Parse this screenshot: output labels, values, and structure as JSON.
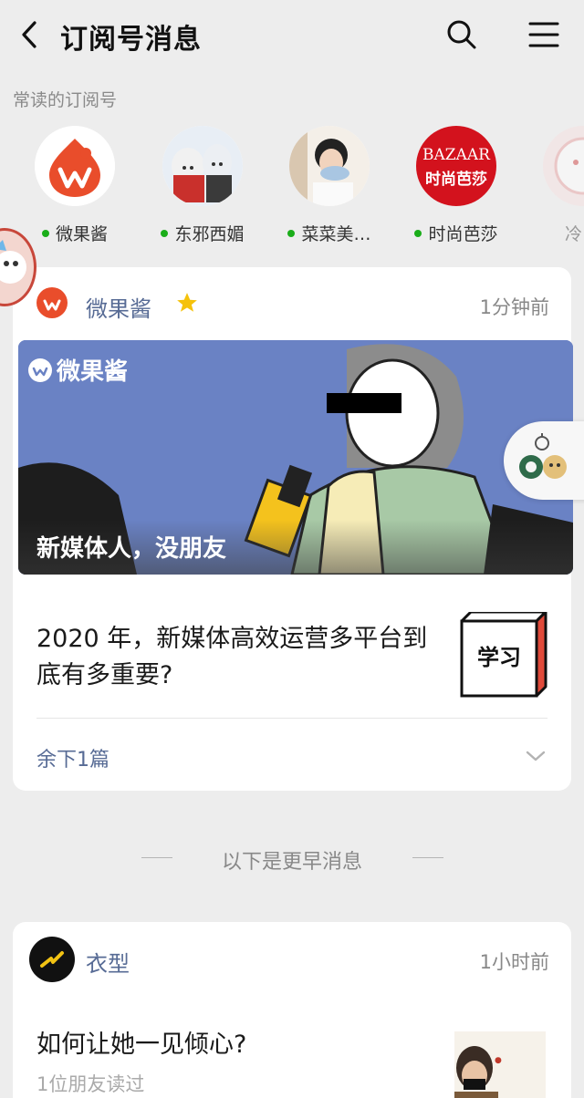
{
  "header": {
    "title": "订阅号消息"
  },
  "frequent": {
    "label": "常读的订阅号",
    "items": [
      {
        "name": "微果酱",
        "has_dot": true
      },
      {
        "name": "东邪西媚",
        "has_dot": true
      },
      {
        "name": "菜菜美…",
        "has_dot": true
      },
      {
        "name": "时尚芭莎",
        "has_dot": true,
        "logo_text_top": "BAZAAR",
        "logo_text_bottom": "时尚芭莎"
      },
      {
        "name": "冷",
        "has_dot": false
      }
    ]
  },
  "card1": {
    "source": "微果酱",
    "time": "1分钟前",
    "cover_brand": "微果酱",
    "cover_caption": "新媒体人，没朋友",
    "title": "2020 年，新媒体高效运营多平台到底有多重要?",
    "thumb_text": "学习",
    "remaining": "余下1篇"
  },
  "earlier": {
    "label": "以下是更早消息"
  },
  "card2": {
    "source": "衣型",
    "time": "1小时前",
    "title": "如何让她一见倾心?",
    "read_info": "1位朋友读过"
  },
  "colors": {
    "background": "#ededed",
    "link": "#576b95",
    "online_dot": "#1aad19",
    "brand_red": "#e94d2b",
    "star": "#f5c20b"
  }
}
